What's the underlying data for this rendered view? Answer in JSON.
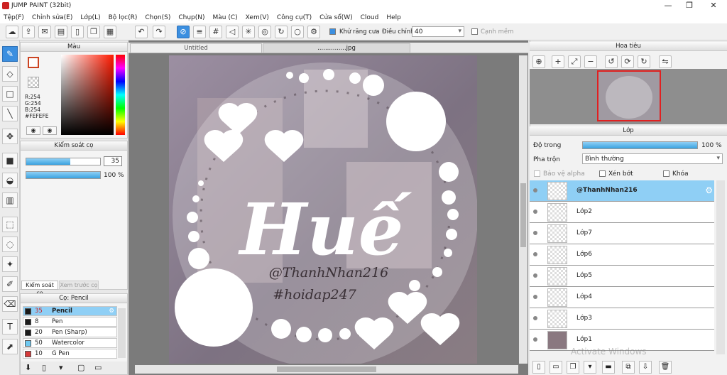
{
  "window": {
    "title": "JUMP PAINT (32bit)",
    "min": "—",
    "max": "❐",
    "close": "✕"
  },
  "menu": [
    "Tệp(F)",
    "Chỉnh sửa(E)",
    "Lớp(L)",
    "Bộ lọc(R)",
    "Chọn(S)",
    "Chụp(N)",
    "Màu (C)",
    "Xem(V)",
    "Công cụ(T)",
    "Cửa sổ(W)",
    "Cloud",
    "Help"
  ],
  "toolbar": {
    "antialias_label": "Khử răng cưa",
    "adjust_label": "Điều chỉnh",
    "adjust_value": "40",
    "edge_label": "Cạnh mềm"
  },
  "color_panel": {
    "title": "Màu",
    "r": "R:254",
    "g": "G:254",
    "b": "B:254",
    "hex": "#FEFEFE",
    "fg_color": "#fefefe",
    "accent": "#3b8fe0"
  },
  "brush_control": {
    "title": "Kiểm soát cọ",
    "size_value": "35",
    "size_fraction": 0.6,
    "opacity_label": "100 %",
    "opacity_fraction": 1.0,
    "tab_active": "Kiểm soát cọ",
    "tab_inactive": "Xem trước cọ"
  },
  "pen_panel": {
    "title": "Cọ: Pencil",
    "items": [
      {
        "size": "35",
        "name": "Pencil",
        "color": "#1a1a1a"
      },
      {
        "size": "8",
        "name": "Pen",
        "color": "#1a1a1a"
      },
      {
        "size": "20",
        "name": "Pen (Sharp)",
        "color": "#1a1a1a"
      },
      {
        "size": "50",
        "name": "Watercolor",
        "color": "#6ec8f0"
      },
      {
        "size": "10",
        "name": "G Pen",
        "color": "#d63a3a"
      }
    ]
  },
  "tabs": {
    "untitled": "Untitled",
    "file": "...............jpg"
  },
  "artwork": {
    "title": "Huế",
    "line1": "@ThanhNhan216",
    "line2": "#hoidap247"
  },
  "navigator": {
    "title": "Hoa tiêu"
  },
  "layers": {
    "title": "Lớp",
    "opacity_label": "Độ trong",
    "opacity_value": "100 %",
    "opacity_fraction": 1.0,
    "blend_label": "Pha trộn",
    "blend_value": "Bình thường",
    "protect_alpha": "Bảo vệ alpha",
    "clip": "Xén bớt",
    "lock": "Khóa",
    "items": [
      "@ThanhNhan216",
      "Lớp2",
      "Lớp7",
      "Lớp6",
      "Lớp5",
      "Lớp4",
      "Lớp3",
      "Lớp1"
    ]
  },
  "watermark": "Activate Windows"
}
